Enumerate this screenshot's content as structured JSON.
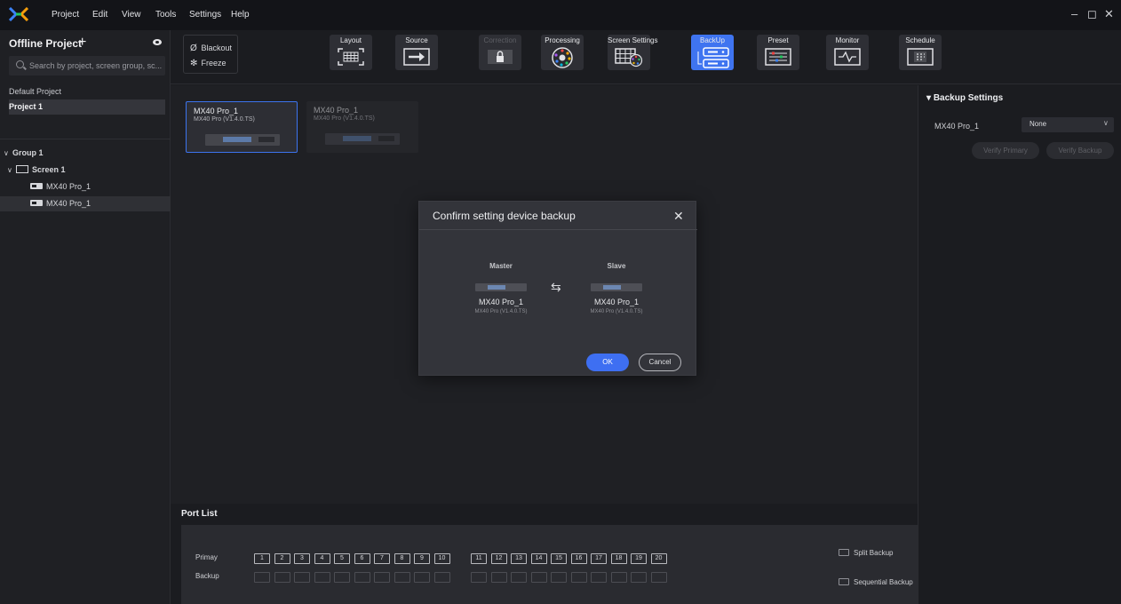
{
  "menubar": {
    "items": [
      "Project",
      "Edit",
      "View",
      "Tools",
      "Settings",
      "Help"
    ],
    "window_controls": [
      "–",
      "◻",
      "✕"
    ]
  },
  "left_panel": {
    "title": "Offline Project",
    "add_symbol": "+",
    "search_placeholder": "Search by project, screen group, sc...",
    "projects": [
      "Default Project",
      "Project 1"
    ],
    "tree": {
      "group": "Group 1",
      "screen": "Screen 1",
      "devices": [
        "MX40 Pro_1",
        "MX40 Pro_1"
      ]
    }
  },
  "toolbar": {
    "blackout": "Blackout",
    "freeze": "Freeze",
    "buttons": [
      {
        "label": "Layout",
        "icon": "layout-icon",
        "state": "normal"
      },
      {
        "label": "Source",
        "icon": "source-icon",
        "state": "normal"
      },
      {
        "label": "Correction",
        "icon": "lock-icon",
        "state": "disabled"
      },
      {
        "label": "Processing",
        "icon": "processing-icon",
        "state": "normal"
      },
      {
        "label": "Screen Settings",
        "icon": "screen-settings-icon",
        "state": "normal"
      },
      {
        "label": "BackUp",
        "icon": "backup-icon",
        "state": "active"
      },
      {
        "label": "Preset",
        "icon": "preset-icon",
        "state": "normal"
      },
      {
        "label": "Monitor",
        "icon": "monitor-icon",
        "state": "normal"
      },
      {
        "label": "Schedule",
        "icon": "schedule-icon",
        "state": "normal"
      }
    ]
  },
  "canvas": {
    "cards": [
      {
        "name": "MX40 Pro_1",
        "version": "MX40 Pro (V1.4.0.TS)",
        "selected": true
      },
      {
        "name": "MX40 Pro_1",
        "version": "MX40 Pro (V1.4.0.TS)",
        "selected": false
      }
    ]
  },
  "dialog": {
    "title": "Confirm setting device backup",
    "close": "✕",
    "master_label": "Master",
    "slave_label": "Slave",
    "master_name": "MX40 Pro_1",
    "master_version": "MX40 Pro (V1.4.0.TS)",
    "slave_name": "MX40 Pro_1",
    "slave_version": "MX40 Pro (V1.4.0.TS)",
    "swap_symbol": "⇆",
    "ok": "OK",
    "cancel": "Cancel"
  },
  "right_panel": {
    "title": "Backup Settings",
    "device_label": "MX40 Pro_1",
    "select_value": "None",
    "verify_primary": "Verify Primary",
    "verify_backup": "Verify Backup"
  },
  "port_list": {
    "title": "Port List",
    "primary_label": "Primay",
    "backup_label": "Backup",
    "ports": [
      "1",
      "2",
      "3",
      "4",
      "5",
      "6",
      "7",
      "8",
      "9",
      "10",
      "11",
      "12",
      "13",
      "14",
      "15",
      "16",
      "17",
      "18",
      "19",
      "20"
    ],
    "split_backup": "Split Backup",
    "sequential_backup": "Sequential Backup"
  },
  "colors": {
    "accent": "#3e6ff2",
    "background": "#1b1c20",
    "panel": "#1f2024"
  }
}
